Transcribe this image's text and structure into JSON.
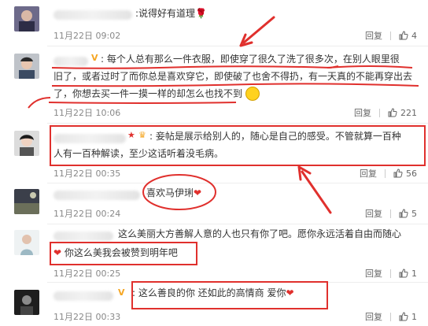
{
  "comments": [
    {
      "text": "说得好有道理",
      "time": "11月22日 09:02",
      "reply": "回复",
      "likes": "4"
    },
    {
      "line1": "每个人总有那么一件衣服，即使穿了很久了洗了很多次，在别人眼里很",
      "line2": "旧了，或者过时了而你总是喜欢穿它，即使破了也舍不得扔，有一天真的不能再穿出去",
      "line3": "了，你想去买一件一摸一样的却怎么也找不到",
      "time": "11月22日 10:06",
      "reply": "回复",
      "likes": "221"
    },
    {
      "line1": "妾帖是展示给别人的，随心是自己的感受。不管就算一百种",
      "line2": "人有一百种解读，至少这话听着没毛病。",
      "time": "11月22日 00:35",
      "reply": "回复",
      "likes": "56"
    },
    {
      "text": "喜欢马伊琍",
      "time": "11月22日 00:24",
      "reply": "回复",
      "likes": "5"
    },
    {
      "line1": "这么美丽大方善解人意的人也只有你了吧。愿你永远活着自由而随心",
      "line2": "你这么美我会被赞到明年吧",
      "time": "11月22日 00:25",
      "reply": "回复",
      "likes": "1"
    },
    {
      "text": "这么善良的你 还如此的高情商 爱你",
      "time": "11月22日 00:33",
      "reply": "回复",
      "likes": "1"
    }
  ],
  "icons": {
    "thumb": "thumbs-up-icon",
    "heart": "heart-icon",
    "rose": "rose-icon",
    "smiley": "smiley-icon"
  },
  "colors": {
    "annotation_red": "#e0302d",
    "vip_badge": "#f5a623"
  }
}
